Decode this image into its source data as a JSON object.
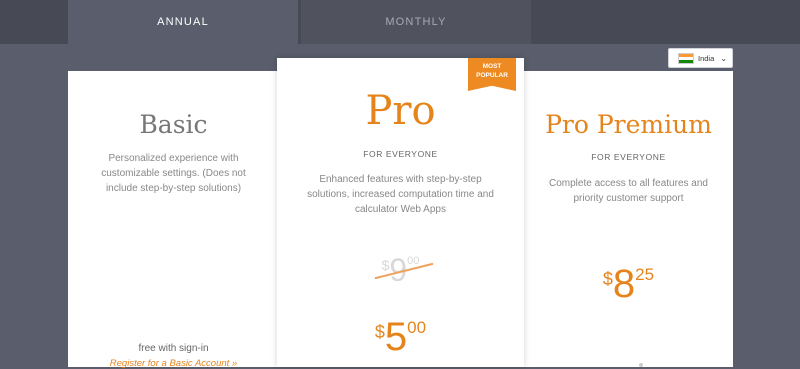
{
  "tabs": [
    {
      "label": "ANNUAL",
      "active": true
    },
    {
      "label": "MONTHLY",
      "active": false
    }
  ],
  "region": {
    "country": "India",
    "flag": "india-flag"
  },
  "colors": {
    "accent": "#e6841c",
    "background": "#5a5d6b",
    "tab_band": "#474a55"
  },
  "plans": {
    "basic": {
      "title": "Basic",
      "description": "Personalized experience with customizable settings. (Does not include step-by-step solutions)",
      "note": "free with sign-in",
      "link": "Register for a Basic Account »"
    },
    "pro": {
      "badge": "MOST POPULAR",
      "title": "Pro",
      "subtitle": "FOR EVERYONE",
      "description": "Enhanced features with step-by-step solutions, increased computation time and calculator Web Apps",
      "old_price": {
        "currency": "$",
        "whole": "9",
        "cents": "00"
      },
      "price": {
        "currency": "$",
        "whole": "5",
        "cents": "00"
      }
    },
    "premium": {
      "title": "Pro Premium",
      "subtitle": "FOR EVERYONE",
      "description": "Complete access to all features and priority customer support",
      "price": {
        "currency": "$",
        "whole": "8",
        "cents": "25"
      }
    }
  }
}
